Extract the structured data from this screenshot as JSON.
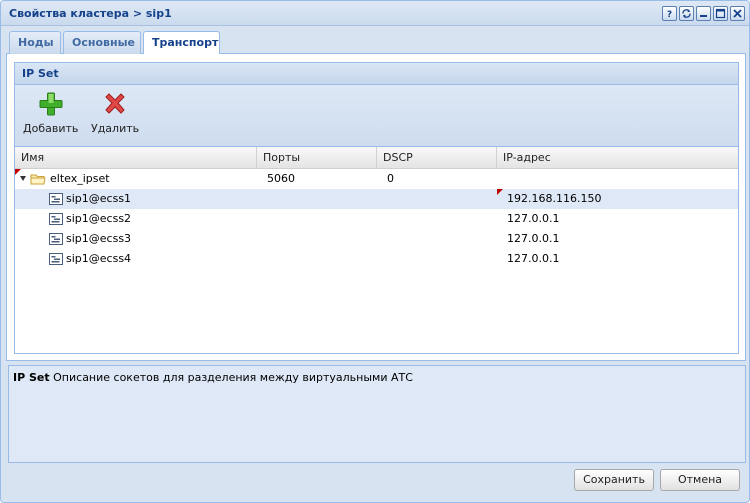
{
  "window": {
    "title": "Свойства кластера > sip1"
  },
  "tabs": [
    {
      "label": "Ноды",
      "active": false
    },
    {
      "label": "Основные",
      "active": false
    },
    {
      "label": "Транспорт",
      "active": true
    }
  ],
  "panel": {
    "title": "IP Set",
    "toolbar": {
      "add_label": "Добавить",
      "delete_label": "Удалить"
    }
  },
  "grid": {
    "columns": [
      "Имя",
      "Порты",
      "DSCP",
      "IP-адрес"
    ],
    "group": {
      "name": "eltex_ipset",
      "ports": "5060",
      "dscp": "0",
      "ip": ""
    },
    "rows": [
      {
        "name": "sip1@ecss1",
        "ip": "192.168.116.150"
      },
      {
        "name": "sip1@ecss2",
        "ip": "127.0.0.1"
      },
      {
        "name": "sip1@ecss3",
        "ip": "127.0.0.1"
      },
      {
        "name": "sip1@ecss4",
        "ip": "127.0.0.1"
      }
    ]
  },
  "description": {
    "term": "IP Set",
    "text": "Описание сокетов для разделения между виртуальными АТС"
  },
  "footer": {
    "save_label": "Сохранить",
    "cancel_label": "Отмена"
  },
  "colors": {
    "accent": "#15428b",
    "border": "#99bbe8",
    "selected_row": "#dfe8f6",
    "dirty_marker": "#c00000"
  }
}
